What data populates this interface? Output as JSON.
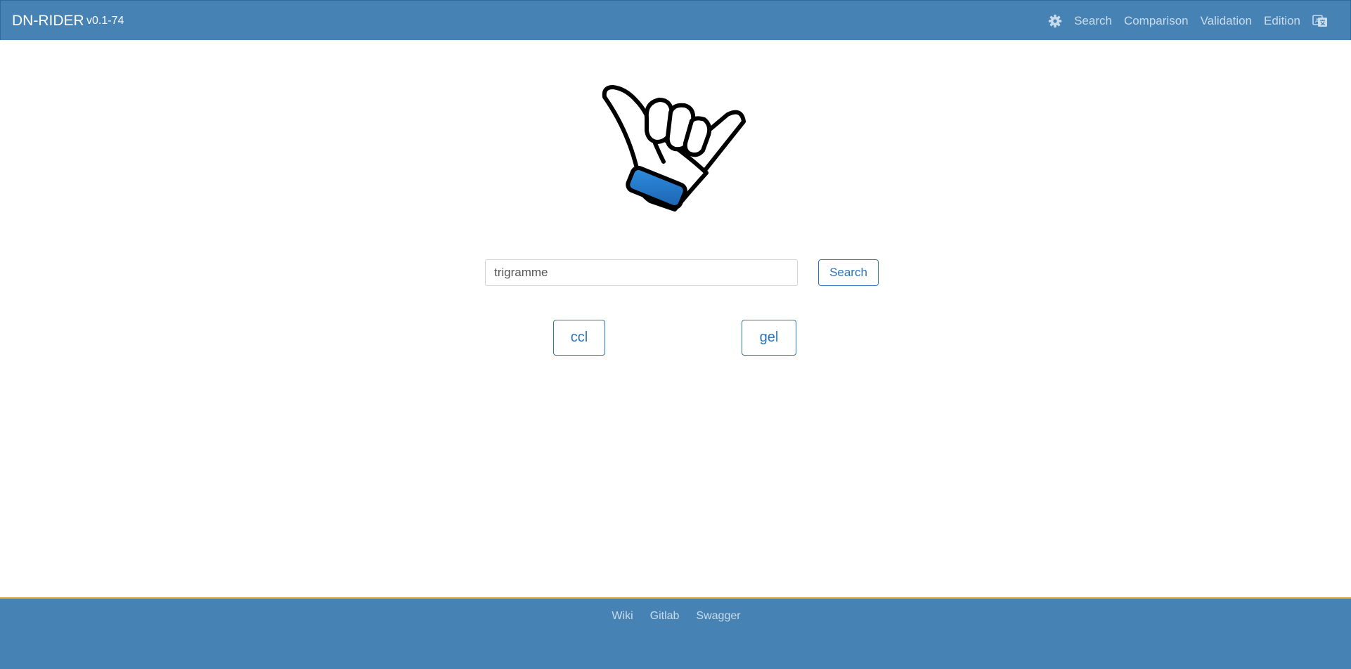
{
  "header": {
    "brand": "DN-RIDER",
    "version": "v0.1-74",
    "nav": {
      "settings_icon": "gear-icon",
      "search": "Search",
      "comparison": "Comparison",
      "validation": "Validation",
      "edition": "Edition",
      "language_icon": "translate-icon"
    }
  },
  "logo": {
    "icon": "shaka-hand-icon",
    "accent_color": "#2a7fd0"
  },
  "search": {
    "placeholder": "trigramme",
    "value": "",
    "button_label": "Search"
  },
  "users": [
    {
      "label": "ccl"
    },
    {
      "label": "gel"
    }
  ],
  "footer": {
    "links": [
      "Wiki",
      "Gitlab",
      "Swagger"
    ]
  },
  "colors": {
    "primary": "#4682b4",
    "button_border": "#2a73b8",
    "footer_accent": "#e0a030"
  }
}
